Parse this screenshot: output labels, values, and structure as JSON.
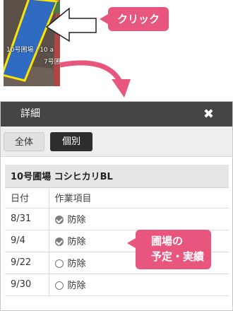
{
  "map": {
    "field_label": "10号圃場 / 10 a",
    "field_label_second": "7号圃"
  },
  "callouts": {
    "click": "クリック",
    "status_line1": "圃場の",
    "status_line2": "予定・実績"
  },
  "panel": {
    "title": "詳細",
    "close": "✖",
    "tabs": [
      "全体",
      "個別"
    ],
    "active_tab": "個別",
    "table": {
      "caption": "10号圃場 コシヒカリBL",
      "headers": {
        "date": "日付",
        "task": "作業項目"
      },
      "rows": [
        {
          "date": "8/31",
          "task": "防除",
          "status": "done"
        },
        {
          "date": "9/4",
          "task": "防除",
          "status": "done"
        },
        {
          "date": "9/22",
          "task": "防除",
          "status": "todo"
        },
        {
          "date": "9/30",
          "task": "防除",
          "status": "todo"
        }
      ]
    }
  },
  "colors": {
    "accent_pink": "#e8567e",
    "field_blue": "#2e6bc1",
    "field_outline": "#ffe400",
    "header_dark": "#454545"
  },
  "icons": {
    "close": "close-icon",
    "done": "check-circle-icon",
    "todo": "empty-circle-icon",
    "arrow": "pointer-arrow-icon"
  }
}
